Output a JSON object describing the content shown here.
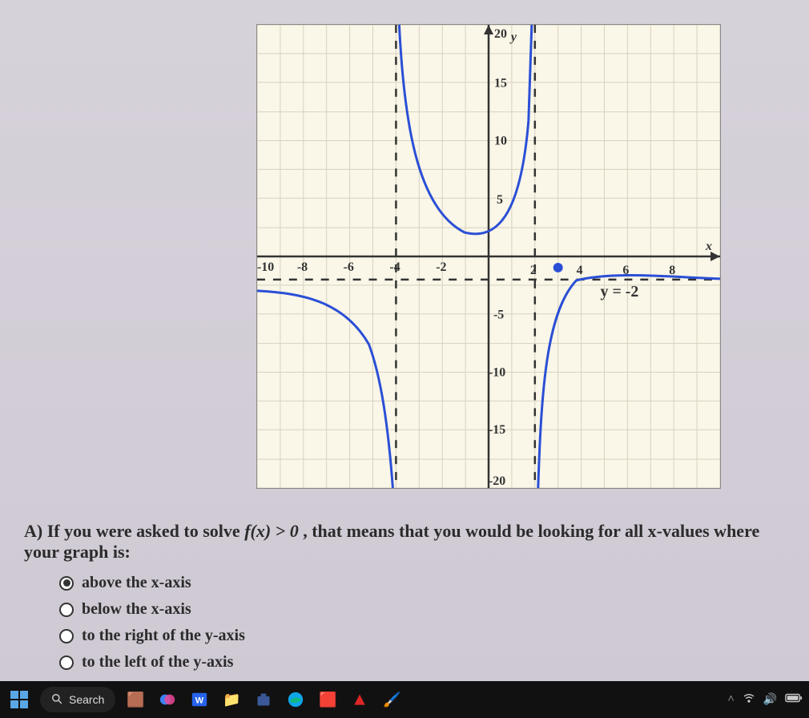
{
  "chart_data": {
    "type": "line",
    "title": "",
    "xlabel": "x",
    "ylabel": "y",
    "xlim": [
      -10,
      10
    ],
    "ylim": [
      -20,
      20
    ],
    "x_ticks": [
      -10,
      -8,
      -6,
      -4,
      -2,
      2,
      4,
      6,
      8
    ],
    "y_ticks": [
      -20,
      -15,
      -10,
      -5,
      5,
      10,
      15,
      20
    ],
    "asymptotes": {
      "vertical": [
        -4,
        2
      ],
      "horizontal": -2,
      "horizontal_label": "y = -2"
    },
    "point_marker": {
      "x": 3,
      "y": -1
    },
    "series": [
      {
        "name": "left-branch",
        "description": "curve approaching y=-2 from below as x→-∞, going to -∞ as x→-4^-"
      },
      {
        "name": "middle-branch",
        "description": "curve from +∞ at x→-4^+ down to local min near (0,2) up to +∞ at x→2^-"
      },
      {
        "name": "right-branch",
        "description": "curve from -∞ at x→2^+ rising toward y=-2 as x→+∞, passing through (3,-1)"
      }
    ]
  },
  "question": {
    "prefix": "A) If you were asked to solve ",
    "func": "f(x) > 0",
    "suffix": ", that means that you would be looking for all x-values where your graph is:"
  },
  "options": [
    {
      "label": "above the x-axis",
      "selected": true
    },
    {
      "label": "below the x-axis",
      "selected": false
    },
    {
      "label": "to the right of the y-axis",
      "selected": false
    },
    {
      "label": "to the left of the y-axis",
      "selected": false
    }
  ],
  "taskbar": {
    "search_placeholder": "Search"
  },
  "axis_labels": {
    "x": "x",
    "y": "y",
    "neg10": "-10",
    "neg8": "-8",
    "neg6": "-6",
    "neg4": "-4",
    "neg2": "-2",
    "p2": "2",
    "p4": "4",
    "p6": "6",
    "p8": "8",
    "y20": "20",
    "y15": "15",
    "y10": "10",
    "y5": "5",
    "yn5": "-5",
    "yn10": "-10",
    "yn15": "-15",
    "yn20": "-20",
    "asymp": "y = -2"
  }
}
